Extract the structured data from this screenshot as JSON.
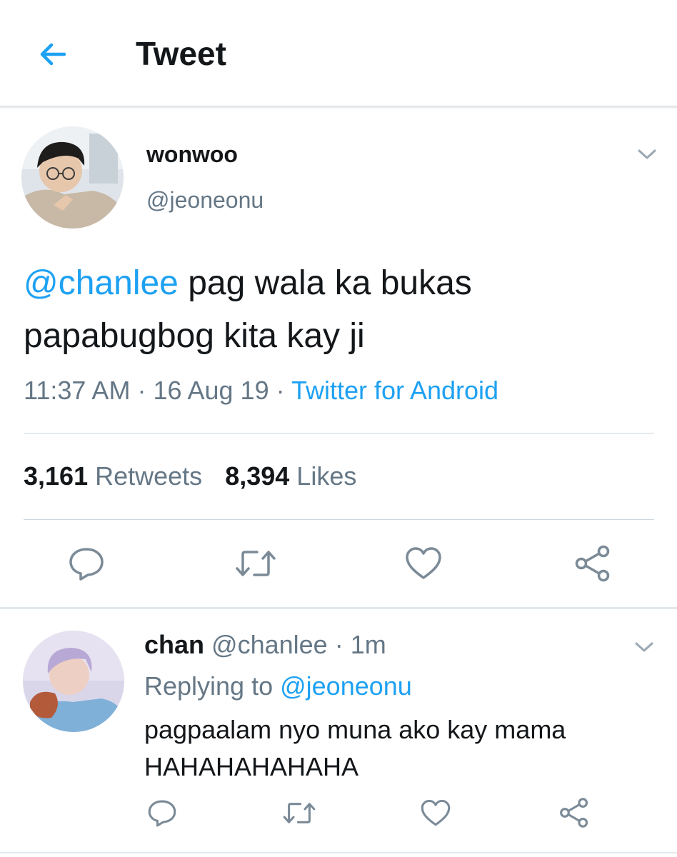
{
  "header": {
    "title": "Tweet",
    "back_icon": "arrow-left-icon",
    "accent": "#1da1f2"
  },
  "tweet": {
    "author_name": "wonwoo",
    "author_handle": "@jeoneonu",
    "mention": "@chanlee",
    "text": " pag wala ka bukas papabugbog kita kay ji",
    "time": "11:37 AM",
    "sep1": " · ",
    "date": "16 Aug 19",
    "sep2": " · ",
    "source": "Twitter for Android",
    "retweets_count": "3,161",
    "retweets_label": "Retweets",
    "likes_count": "8,394",
    "likes_label": "Likes",
    "actions": [
      "reply-icon",
      "retweet-icon",
      "like-icon",
      "share-icon"
    ]
  },
  "reply": {
    "author_name": "chan",
    "author_handle": "@chanlee",
    "sep": " · ",
    "age": "1m",
    "replying_prefix": "Replying to ",
    "replying_handle": "@jeoneonu",
    "text": "pagpaalam nyo muna ako kay mama HAHAHAHAHAHA",
    "actions": [
      "reply-icon",
      "retweet-icon",
      "like-icon",
      "share-icon"
    ]
  }
}
